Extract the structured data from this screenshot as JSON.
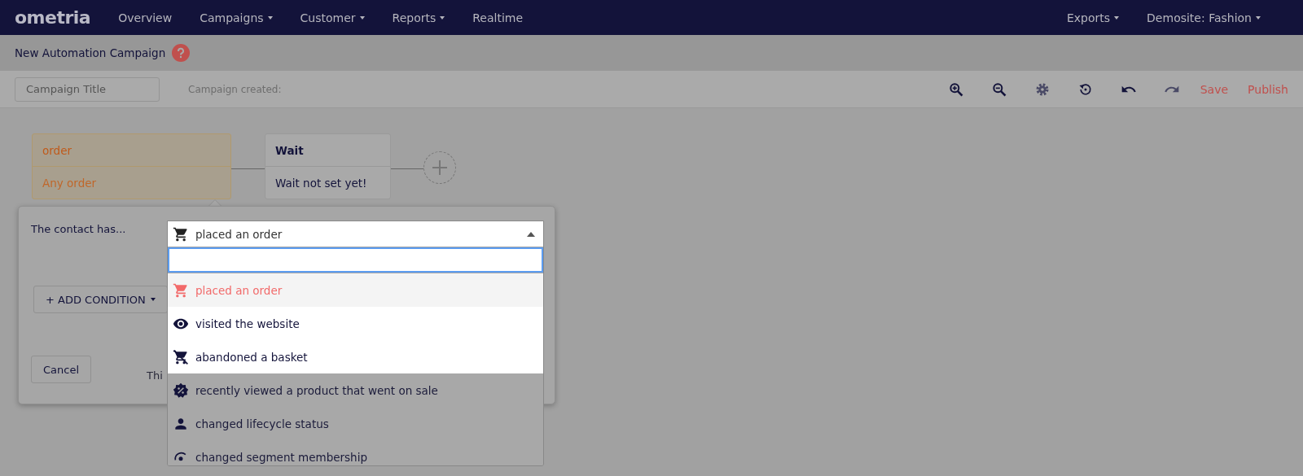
{
  "nav": {
    "logo": "ometria",
    "items": [
      {
        "label": "Overview",
        "dropdown": false
      },
      {
        "label": "Campaigns",
        "dropdown": true
      },
      {
        "label": "Customer",
        "dropdown": true
      },
      {
        "label": "Reports",
        "dropdown": true
      },
      {
        "label": "Realtime",
        "dropdown": false
      }
    ],
    "right_items": [
      {
        "label": "Exports",
        "dropdown": true
      },
      {
        "label": "Demosite: Fashion",
        "dropdown": true
      }
    ]
  },
  "page_title": "New Automation Campaign",
  "toolbar": {
    "title_field": {
      "placeholder": "Campaign Title"
    },
    "created_label": "Campaign created:",
    "tools": [
      {
        "kind": "zoom-in"
      },
      {
        "kind": "zoom-out"
      },
      {
        "kind": "settings"
      },
      {
        "kind": "history"
      },
      {
        "kind": "undo"
      },
      {
        "kind": "redo"
      }
    ],
    "actions": [
      "Save",
      "Publish"
    ]
  },
  "canvas": {
    "nodes": [
      {
        "kind": "trigger",
        "title": "order",
        "subtitle": "Any order"
      },
      {
        "kind": "wait",
        "title": "Wait",
        "subtitle": "Wait not set yet!"
      }
    ]
  },
  "popover": {
    "label": "The contact has...",
    "select": {
      "kind": "cart",
      "value": "placed an order",
      "expanded": true
    },
    "options": [
      {
        "kind": "cart",
        "label": "placed an order",
        "selected": true
      },
      {
        "kind": "eye",
        "label": "visited the website",
        "selected": false
      },
      {
        "kind": "cart-off",
        "label": "abandoned a basket",
        "selected": false
      },
      {
        "kind": "sale",
        "label": "recently viewed a product that went on sale",
        "selected": false
      },
      {
        "kind": "person",
        "label": "changed lifecycle status",
        "selected": false
      },
      {
        "kind": "segment",
        "label": "changed segment membership",
        "selected": false
      }
    ],
    "add_condition": "+ ADD CONDITION",
    "cancel": "Cancel",
    "note": "Thi"
  }
}
